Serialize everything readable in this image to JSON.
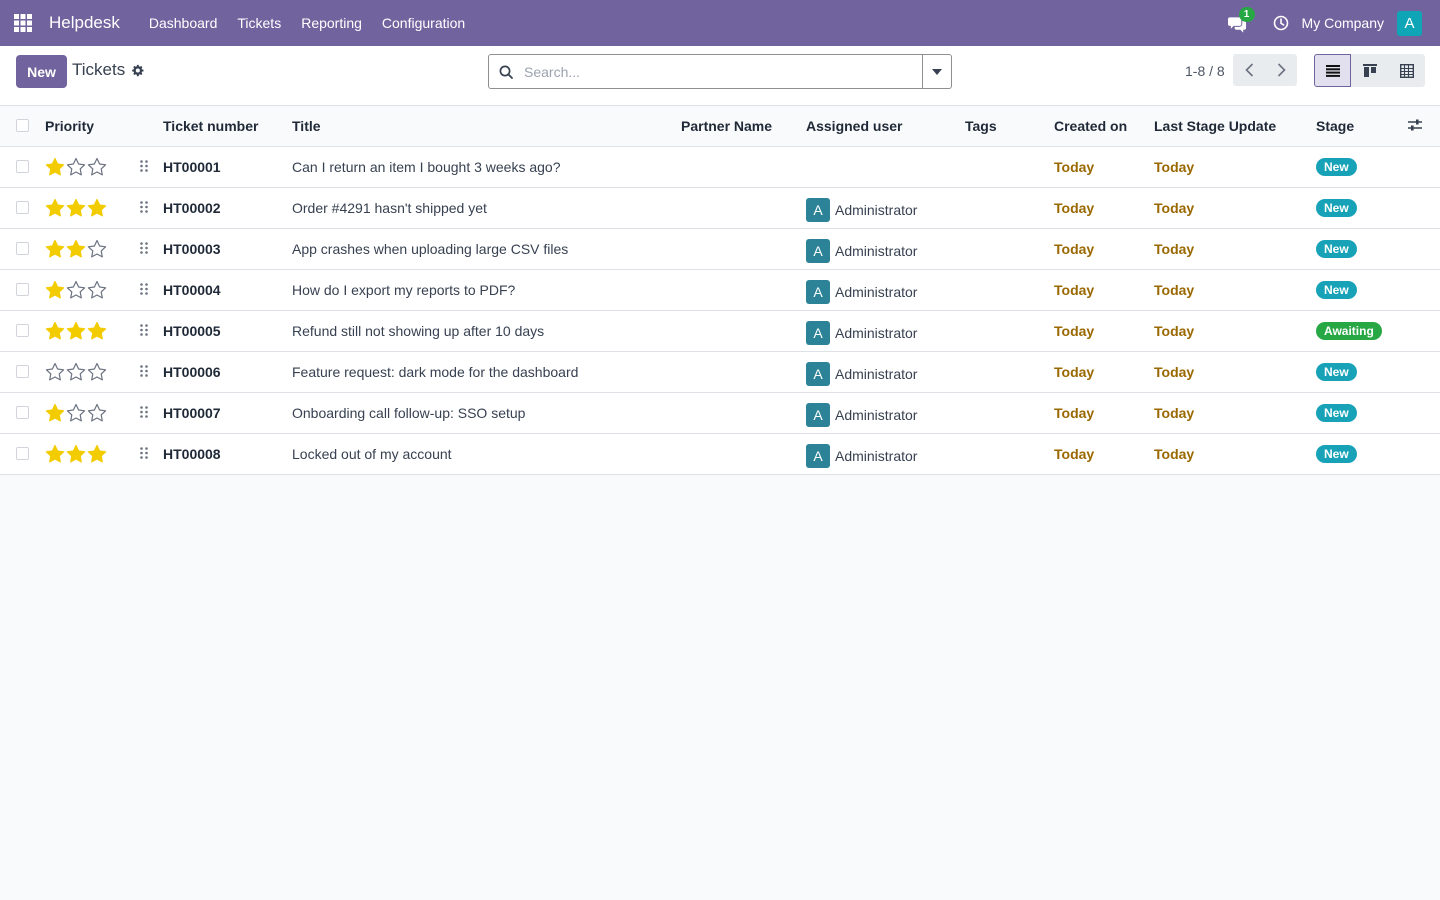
{
  "navbar": {
    "app_name": "Helpdesk",
    "menu": [
      "Dashboard",
      "Tickets",
      "Reporting",
      "Configuration"
    ],
    "chat_badge": "1",
    "company": "My Company",
    "user_initial": "A"
  },
  "control": {
    "new_label": "New",
    "title": "Tickets",
    "search_placeholder": "Search...",
    "pager": "1-8 / 8"
  },
  "table": {
    "columns": [
      "Priority",
      "Ticket number",
      "Title",
      "Partner Name",
      "Assigned user",
      "Tags",
      "Created on",
      "Last Stage Update",
      "Stage"
    ],
    "rows": [
      {
        "priority": 1,
        "number": "HT00001",
        "title": "Can I return an item I bought 3 weeks ago?",
        "partner": "",
        "assigned_initial": "",
        "assigned": "",
        "tags": "",
        "created": "Today",
        "updated": "Today",
        "stage": "New"
      },
      {
        "priority": 3,
        "number": "HT00002",
        "title": "Order #4291 hasn't shipped yet",
        "partner": "",
        "assigned_initial": "A",
        "assigned": "Administrator",
        "tags": "",
        "created": "Today",
        "updated": "Today",
        "stage": "New"
      },
      {
        "priority": 2,
        "number": "HT00003",
        "title": "App crashes when uploading large CSV files",
        "partner": "",
        "assigned_initial": "A",
        "assigned": "Administrator",
        "tags": "",
        "created": "Today",
        "updated": "Today",
        "stage": "New"
      },
      {
        "priority": 1,
        "number": "HT00004",
        "title": "How do I export my reports to PDF?",
        "partner": "",
        "assigned_initial": "A",
        "assigned": "Administrator",
        "tags": "",
        "created": "Today",
        "updated": "Today",
        "stage": "New"
      },
      {
        "priority": 3,
        "number": "HT00005",
        "title": "Refund still not showing up after 10 days",
        "partner": "",
        "assigned_initial": "A",
        "assigned": "Administrator",
        "tags": "",
        "created": "Today",
        "updated": "Today",
        "stage": "Awaiting"
      },
      {
        "priority": 0,
        "number": "HT00006",
        "title": "Feature request: dark mode for the dashboard",
        "partner": "",
        "assigned_initial": "A",
        "assigned": "Administrator",
        "tags": "",
        "created": "Today",
        "updated": "Today",
        "stage": "New"
      },
      {
        "priority": 1,
        "number": "HT00007",
        "title": "Onboarding call follow-up: SSO setup",
        "partner": "",
        "assigned_initial": "A",
        "assigned": "Administrator",
        "tags": "",
        "created": "Today",
        "updated": "Today",
        "stage": "New"
      },
      {
        "priority": 3,
        "number": "HT00008",
        "title": "Locked out of my account",
        "partner": "",
        "assigned_initial": "A",
        "assigned": "Administrator",
        "tags": "",
        "created": "Today",
        "updated": "Today",
        "stage": "New"
      }
    ]
  },
  "colors": {
    "brand": "#71639e",
    "star_filled": "#f3cc00",
    "date_warning": "#9a6800",
    "stage_new": "#17a2b8",
    "stage_awaiting": "#28a745",
    "avatar": "#2c8397"
  },
  "icons": {
    "apps": "grid-icon",
    "chat": "chat-icon",
    "activity": "clock-icon",
    "settings": "gear-icon",
    "search": "search-icon",
    "optional_columns": "sliders-icon"
  }
}
